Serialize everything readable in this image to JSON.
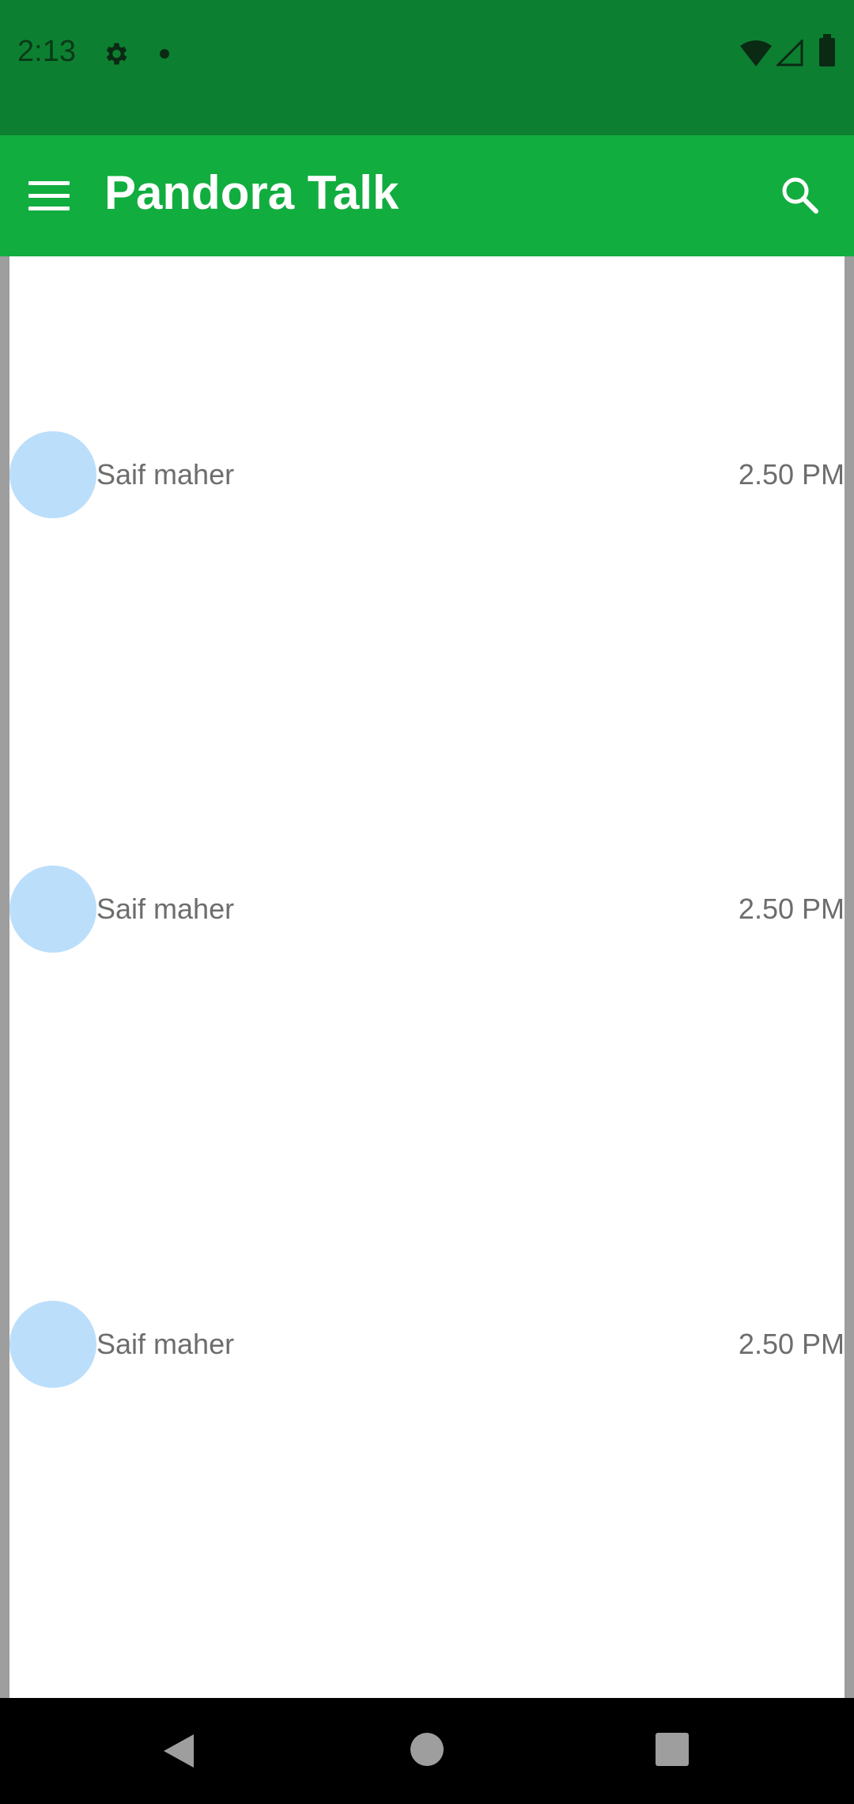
{
  "status_bar": {
    "time": "2:13",
    "icons": [
      "gear-icon",
      "notification-dot-icon",
      "wifi-icon",
      "cell-signal-icon",
      "battery-icon"
    ]
  },
  "app_bar": {
    "title": "Pandora Talk",
    "menu_icon": "hamburger-menu-icon",
    "search_icon": "search-icon",
    "color": "#12ad3f"
  },
  "chats": [
    {
      "name": "Saif maher",
      "time": "2.50 PM"
    },
    {
      "name": "Saif maher",
      "time": "2.50 PM"
    },
    {
      "name": "Saif maher",
      "time": "2.50 PM"
    }
  ],
  "colors": {
    "status_bar": "#0d7f31",
    "avatar": "#bbdefb",
    "text": "#6d6d6d"
  },
  "nav_bar": {
    "icons": [
      "back-icon",
      "home-icon",
      "recents-icon"
    ]
  }
}
